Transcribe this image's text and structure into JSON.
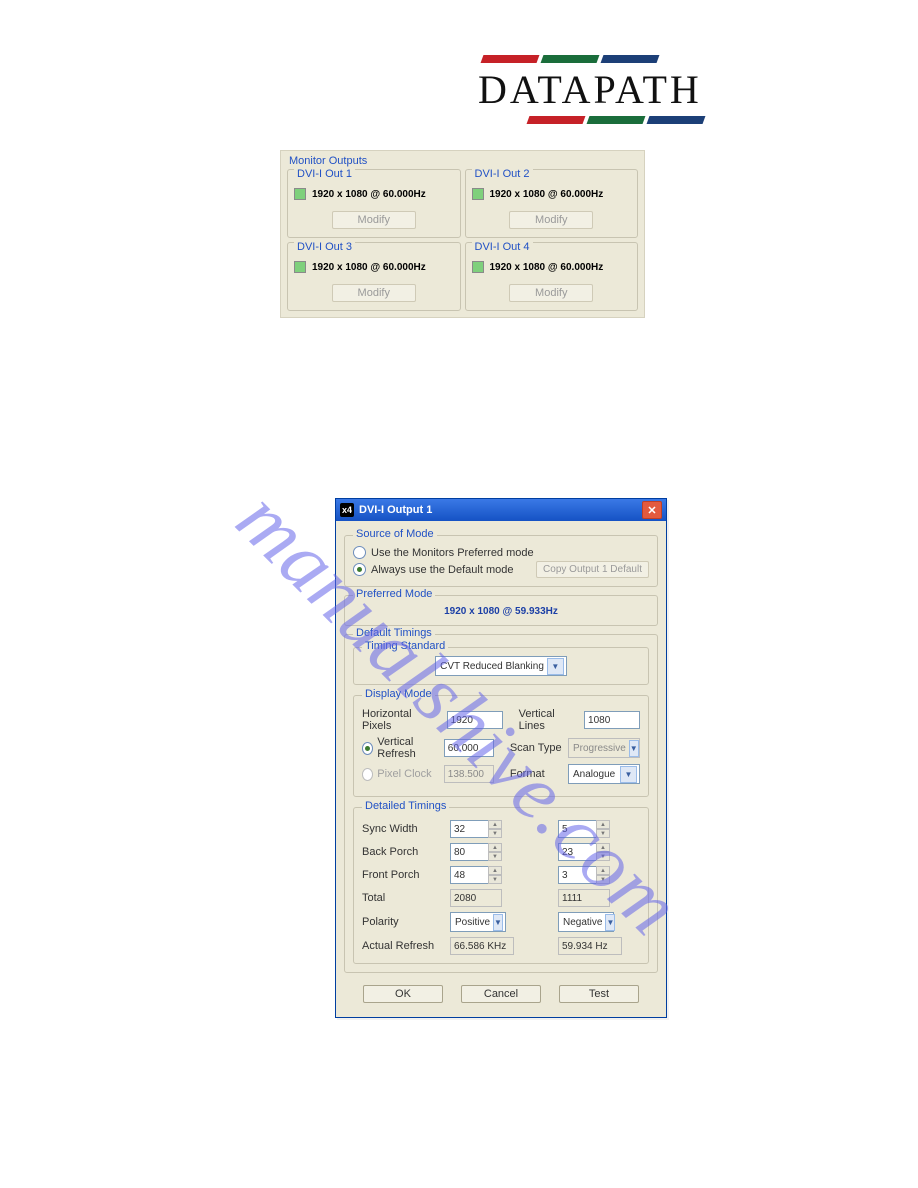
{
  "watermark": "manualshive.com",
  "logo": {
    "text": "DATAPATH"
  },
  "monitor_outputs": {
    "legend": "Monitor Outputs",
    "cells": [
      {
        "title": "DVI-I Out 1",
        "res": "1920 x 1080 @ 60.000Hz",
        "btn": "Modify"
      },
      {
        "title": "DVI-I Out 2",
        "res": "1920 x 1080 @ 60.000Hz",
        "btn": "Modify"
      },
      {
        "title": "DVI-I Out 3",
        "res": "1920 x 1080 @ 60.000Hz",
        "btn": "Modify"
      },
      {
        "title": "DVI-I Out 4",
        "res": "1920 x 1080 @ 60.000Hz",
        "btn": "Modify"
      }
    ]
  },
  "dialog": {
    "icon": "x4",
    "title": "DVI-I Output 1",
    "source_of_mode": {
      "legend": "Source of Mode",
      "opt_preferred": "Use the Monitors Preferred mode",
      "opt_default": "Always use the Default mode",
      "copy_btn": "Copy Output 1 Default"
    },
    "preferred_mode": {
      "legend": "Preferred Mode",
      "value": "1920 x 1080 @ 59.933Hz"
    },
    "default_timings": {
      "legend": "Default Timings",
      "timing_standard": {
        "legend": "Timing Standard",
        "value": "CVT Reduced Blanking"
      },
      "display_mode": {
        "legend": "Display Mode",
        "hpix_label": "Horizontal Pixels",
        "hpix": "1920",
        "vlines_label": "Vertical Lines",
        "vlines": "1080",
        "vref_label": "Vertical Refresh",
        "vref": "60.000",
        "scantype_label": "Scan Type",
        "scantype": "Progressive",
        "pclk_label": "Pixel Clock",
        "pclk": "138.500",
        "format_label": "Format",
        "format": "Analogue"
      },
      "detailed_timings": {
        "legend": "Detailed Timings",
        "rows": {
          "sync_width": {
            "label": "Sync Width",
            "h": "32",
            "v": "5"
          },
          "back_porch": {
            "label": "Back Porch",
            "h": "80",
            "v": "23"
          },
          "front_porch": {
            "label": "Front Porch",
            "h": "48",
            "v": "3"
          },
          "total": {
            "label": "Total",
            "h": "2080",
            "v": "1111"
          },
          "polarity": {
            "label": "Polarity",
            "h": "Positive",
            "v": "Negative"
          },
          "actual_refresh": {
            "label": "Actual Refresh",
            "h": "66.586 KHz",
            "v": "59.934 Hz"
          }
        }
      }
    },
    "buttons": {
      "ok": "OK",
      "cancel": "Cancel",
      "test": "Test"
    }
  }
}
